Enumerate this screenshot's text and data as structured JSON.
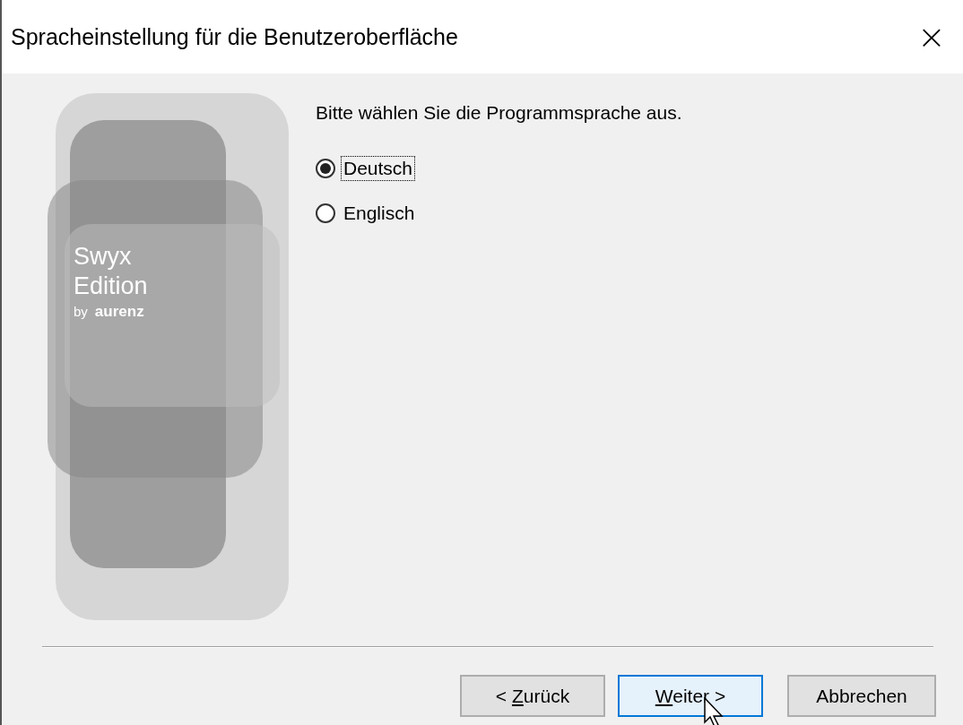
{
  "window": {
    "title": "Spracheinstellung für die Benutzeroberfläche",
    "close": "×"
  },
  "logo": {
    "line_1": "Swyx",
    "line_2": "Edition",
    "by": "by",
    "brand": "aurenz"
  },
  "prompt": "Bitte wählen Sie die Programmsprache aus.",
  "options": [
    {
      "label": "Deutsch",
      "selected": true,
      "focused": true
    },
    {
      "label": "Englisch",
      "selected": false,
      "focused": false
    }
  ],
  "buttons": [
    {
      "kind": "back",
      "prefix": "< ",
      "key": "Z",
      "rest": "urück",
      "default": false,
      "hover": false
    },
    {
      "kind": "next",
      "key": "W",
      "rest": "eiter >",
      "default": true,
      "hover": true
    },
    {
      "kind": "cancel",
      "rest": "Abbrechen",
      "default": false,
      "hover": false
    }
  ]
}
